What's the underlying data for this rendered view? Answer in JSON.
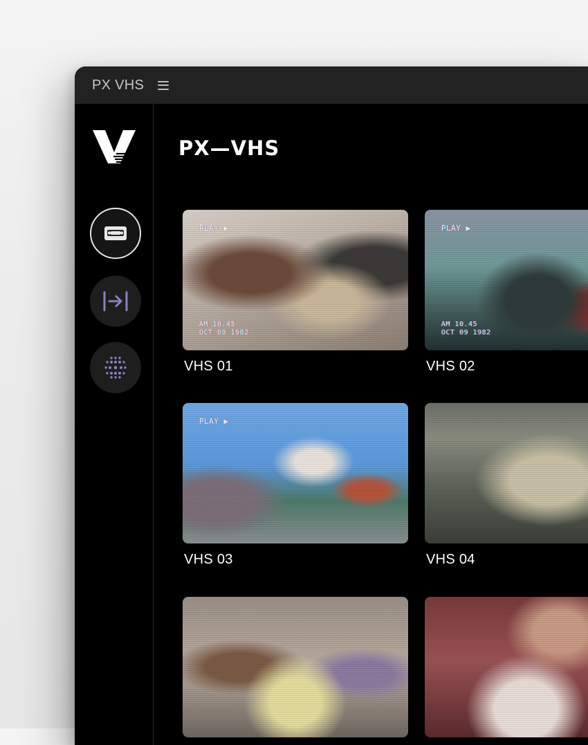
{
  "app": {
    "title": "PX VHS"
  },
  "page": {
    "title": "PX—VHS"
  },
  "sidebar": {
    "items": [
      {
        "name": "cassette",
        "icon": "vhs-cassette-icon",
        "active": true
      },
      {
        "name": "export",
        "icon": "arrow-into-bracket-icon",
        "active": false
      },
      {
        "name": "grain",
        "icon": "dot-grid-icon",
        "active": false
      }
    ]
  },
  "osd": {
    "play": "PLAY ▶",
    "time": "AM 10.45",
    "date": "OCT 09 1982"
  },
  "cards": [
    {
      "label": "VHS 01"
    },
    {
      "label": "VHS 02"
    },
    {
      "label": "VHS 03"
    },
    {
      "label": "VHS 04"
    },
    {
      "label": ""
    },
    {
      "label": ""
    }
  ],
  "colors": {
    "accent": "#8d7fc0",
    "window_bg": "#000000",
    "titlebar": "#222222"
  }
}
